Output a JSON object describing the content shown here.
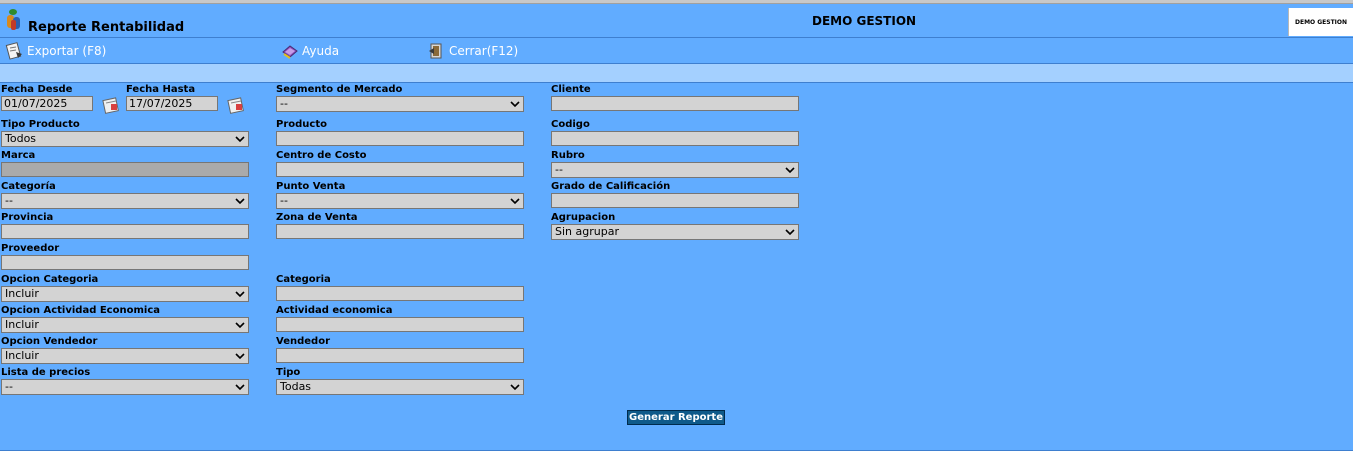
{
  "header": {
    "title": "Reporte Rentabilidad",
    "company": "DEMO GESTION",
    "logo_text": "DEMO GESTION",
    "app_icon": "app-icon"
  },
  "toolbar": {
    "export_label": "Exportar (F8)",
    "help_label": "Ayuda",
    "close_label": "Cerrar(F12)"
  },
  "form": {
    "fecha_desde": {
      "label": "Fecha Desde",
      "value": "01/07/2025"
    },
    "fecha_hasta": {
      "label": "Fecha Hasta",
      "value": "17/07/2025"
    },
    "segmento": {
      "label": "Segmento de Mercado",
      "value": "--"
    },
    "cliente": {
      "label": "Cliente",
      "value": ""
    },
    "tipo_producto": {
      "label": "Tipo Producto",
      "value": "Todos"
    },
    "producto": {
      "label": "Producto",
      "value": ""
    },
    "codigo": {
      "label": "Codigo",
      "value": ""
    },
    "marca": {
      "label": "Marca",
      "value": ""
    },
    "centro_costo": {
      "label": "Centro de Costo",
      "value": ""
    },
    "rubro": {
      "label": "Rubro",
      "value": "--"
    },
    "categoria": {
      "label": "Categoría",
      "value": "--"
    },
    "punto_venta": {
      "label": "Punto Venta",
      "value": "--"
    },
    "grado": {
      "label": "Grado de Calificación",
      "value": ""
    },
    "provincia": {
      "label": "Provincia",
      "value": ""
    },
    "zona_venta": {
      "label": "Zona de Venta",
      "value": ""
    },
    "agrupacion": {
      "label": "Agrupacion",
      "value": "Sin agrupar"
    },
    "proveedor": {
      "label": "Proveedor",
      "value": ""
    },
    "opcion_categoria": {
      "label": "Opcion Categoria",
      "value": "Incluir"
    },
    "categoria2": {
      "label": "Categoria",
      "value": ""
    },
    "opcion_actividad": {
      "label": "Opcion Actividad Economica",
      "value": "Incluir"
    },
    "actividad": {
      "label": "Actividad economica",
      "value": ""
    },
    "opcion_vendedor": {
      "label": "Opcion Vendedor",
      "value": "Incluir"
    },
    "vendedor": {
      "label": "Vendedor",
      "value": ""
    },
    "lista_precios": {
      "label": "Lista de precios",
      "value": "--"
    },
    "tipo": {
      "label": "Tipo",
      "value": "Todas"
    }
  },
  "actions": {
    "generate_label": "Generar Reporte"
  },
  "colors": {
    "background": "#61acff",
    "strip": "#a4d0ff",
    "field": "#d3d3d3",
    "button": "#0f5a8a"
  }
}
